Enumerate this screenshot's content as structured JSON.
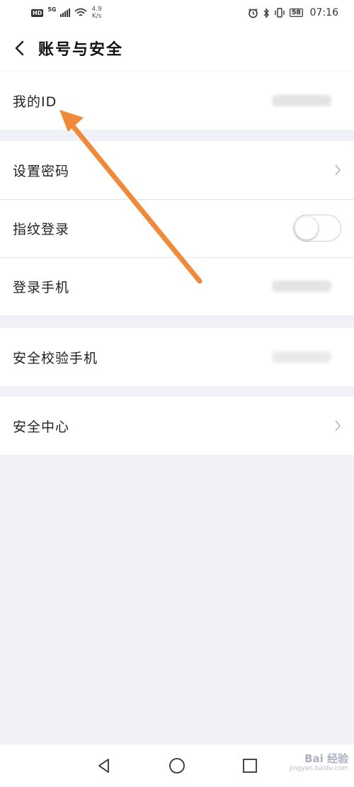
{
  "status_bar": {
    "hd": "HD",
    "network": "5G",
    "speed_value": "4.9",
    "speed_unit": "K/s",
    "battery": "58",
    "time": "07:16"
  },
  "header": {
    "title": "账号与安全"
  },
  "groups": [
    {
      "items": [
        {
          "label": "我的ID",
          "value": "blurred"
        }
      ]
    },
    {
      "items": [
        {
          "label": "设置密码",
          "accessory": "chevron"
        },
        {
          "label": "指纹登录",
          "accessory": "toggle",
          "enabled": false
        },
        {
          "label": "登录手机",
          "value": "blurred"
        }
      ]
    },
    {
      "items": [
        {
          "label": "安全校验手机",
          "value": "blurred"
        }
      ]
    },
    {
      "items": [
        {
          "label": "安全中心",
          "accessory": "chevron"
        }
      ]
    }
  ],
  "watermark": {
    "brand": "Bai 经验",
    "url": "jingyan.baidu.com"
  },
  "annotation": {
    "color": "#f0893a"
  },
  "colors": {
    "background": "#f0f2f7",
    "surface": "#ffffff",
    "text": "#222222",
    "arrow": "#f0893a"
  }
}
